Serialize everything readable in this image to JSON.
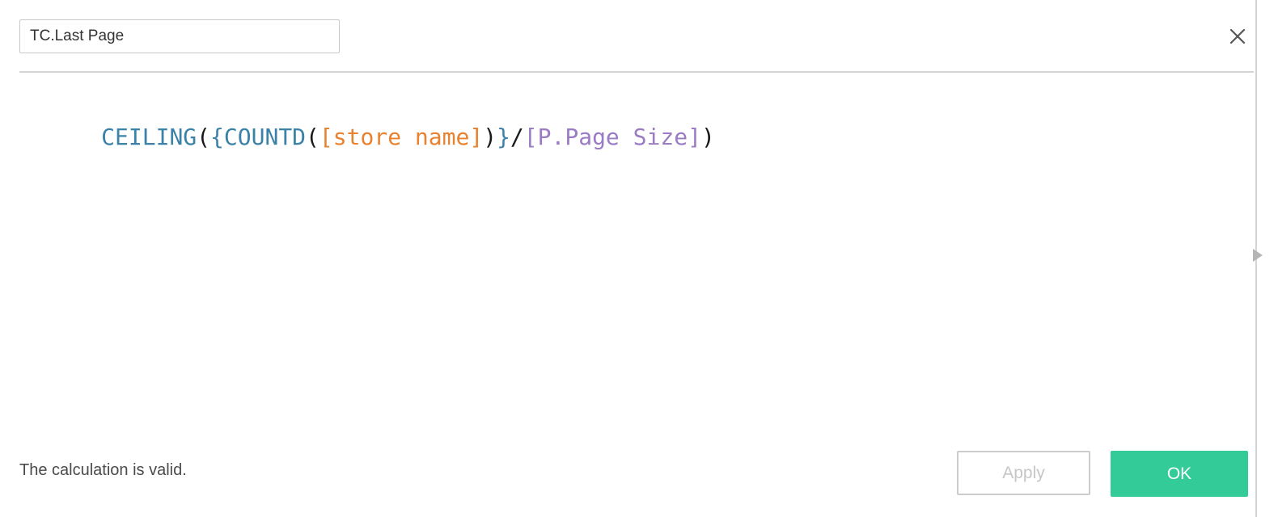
{
  "dialog": {
    "name": "calculated-field-editor"
  },
  "header": {
    "field_name_value": "TC.Last Page",
    "field_name_placeholder": "Name",
    "close_icon": "close-icon"
  },
  "formula": {
    "full_text": "CEILING({COUNTD([store name])}/[P.Page Size])",
    "tokens": [
      {
        "text": "CEILING",
        "type": "function"
      },
      {
        "text": "(",
        "type": "punct"
      },
      {
        "text": "{",
        "type": "brace"
      },
      {
        "text": "COUNTD",
        "type": "function"
      },
      {
        "text": "(",
        "type": "punct"
      },
      {
        "text": "[store name]",
        "type": "field"
      },
      {
        "text": ")",
        "type": "punct"
      },
      {
        "text": "}",
        "type": "brace"
      },
      {
        "text": "/",
        "type": "operator"
      },
      {
        "text": "[P.Page Size]",
        "type": "parameter"
      },
      {
        "text": ")",
        "type": "punct"
      }
    ],
    "colors": {
      "function": "#3b82a8",
      "brace": "#3b82a8",
      "field": "#e8822f",
      "parameter": "#9b7bc4",
      "punct": "#1a1a1a",
      "operator": "#1a1a1a"
    }
  },
  "rail": {
    "expand_icon": "triangle-right-icon"
  },
  "footer": {
    "status_text": "The calculation is valid.",
    "apply_label": "Apply",
    "ok_label": "OK",
    "ok_color": "#33cc99"
  }
}
